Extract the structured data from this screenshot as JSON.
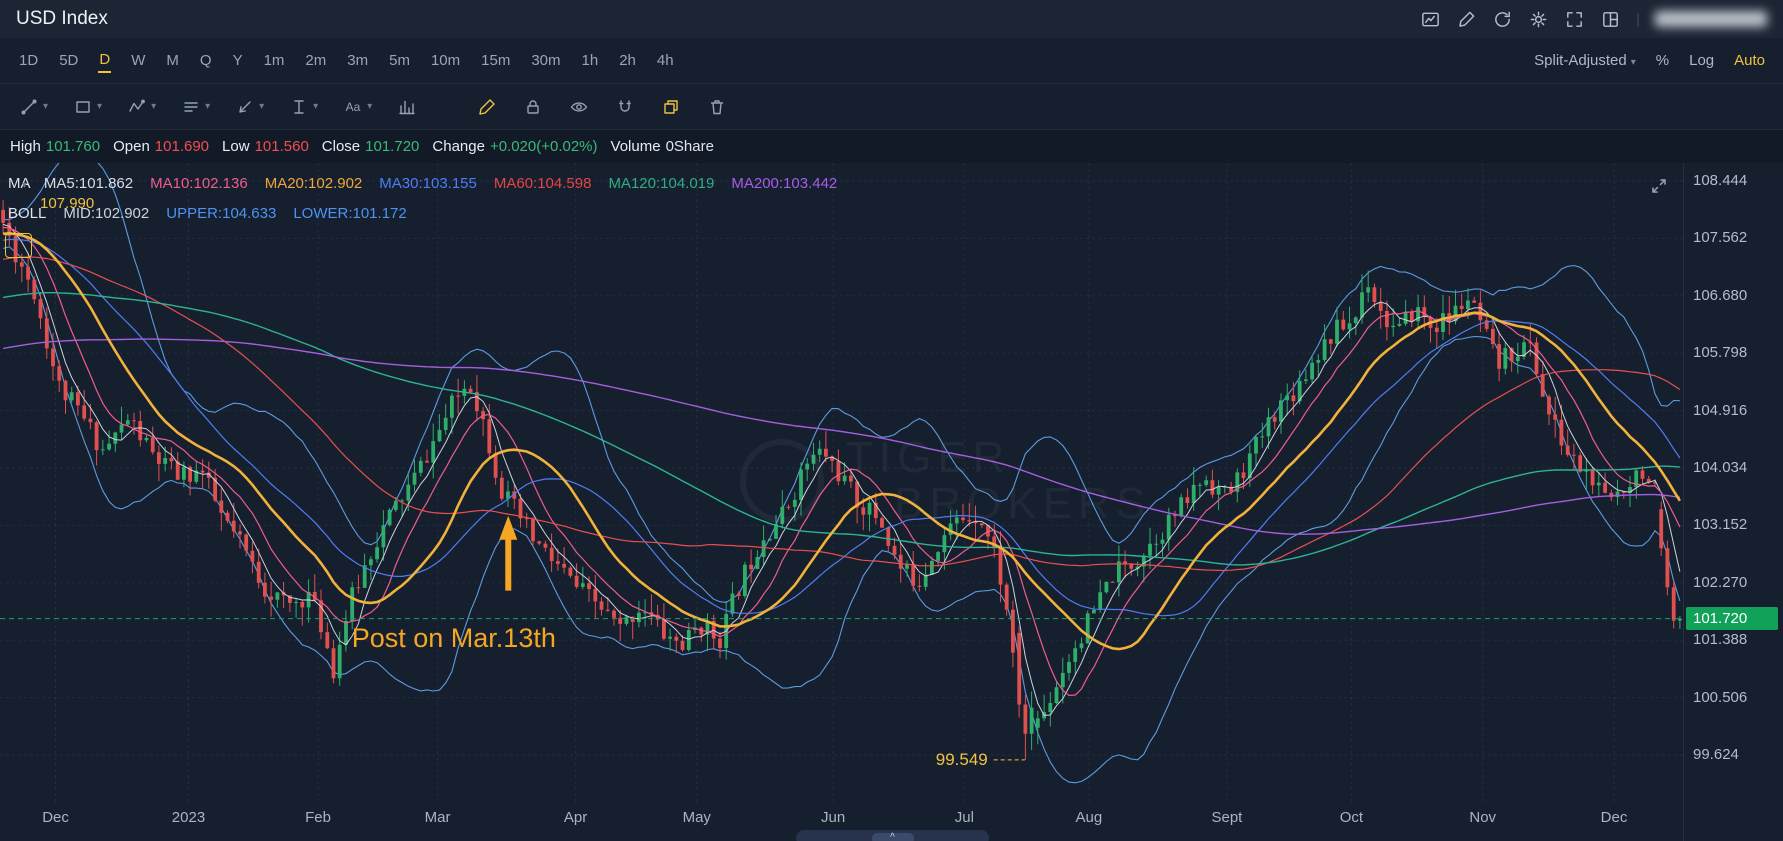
{
  "header": {
    "title": "USD Index",
    "icons": [
      "screenshot-icon",
      "edit-chart-icon",
      "refresh-icon",
      "settings-icon",
      "fullscreen-icon",
      "layout-grid-icon"
    ]
  },
  "timeframe_bar": {
    "items": [
      {
        "label": "1D"
      },
      {
        "label": "5D"
      },
      {
        "label": "D",
        "active": true
      },
      {
        "label": "W"
      },
      {
        "label": "M"
      },
      {
        "label": "Q"
      },
      {
        "label": "Y"
      },
      {
        "label": "1m"
      },
      {
        "label": "2m"
      },
      {
        "label": "3m"
      },
      {
        "label": "5m"
      },
      {
        "label": "10m"
      },
      {
        "label": "15m"
      },
      {
        "label": "30m"
      },
      {
        "label": "1h"
      },
      {
        "label": "2h"
      },
      {
        "label": "4h"
      }
    ],
    "right": {
      "adjust_label": "Split-Adjusted",
      "percent_label": "%",
      "log_label": "Log",
      "auto_label": "Auto"
    }
  },
  "toolbar": {
    "tools": [
      "trend-line",
      "rectangle",
      "wave",
      "parallel-lines",
      "arrow",
      "price-range",
      "text",
      "volume-profile"
    ],
    "actions": [
      "brush",
      "lock",
      "visibility",
      "magnet",
      "duplicate",
      "delete"
    ],
    "text_tool_glyph": "Aa"
  },
  "ohlc": {
    "items": [
      {
        "label": "High",
        "value": "101.760",
        "color": "#3cb878"
      },
      {
        "label": "Open",
        "value": "101.690",
        "color": "#f04f4f"
      },
      {
        "label": "Low",
        "value": "101.560",
        "color": "#f04f4f"
      },
      {
        "label": "Close",
        "value": "101.720",
        "color": "#3cb878"
      },
      {
        "label": "Change",
        "value": "+0.020(+0.02%)",
        "color": "#3cb878"
      },
      {
        "label": "Volume",
        "value": "0Share",
        "color": "#dfe4ec"
      }
    ]
  },
  "indicators": {
    "ma": {
      "label": "MA",
      "entries": [
        {
          "label": "MA5:101.862",
          "color": "#d9dde6"
        },
        {
          "label": "MA10:102.136",
          "color": "#ef5d8c"
        },
        {
          "label": "MA20:102.902",
          "color": "#f0a63c"
        },
        {
          "label": "MA30:103.155",
          "color": "#4f7df2"
        },
        {
          "label": "MA60:104.598",
          "color": "#e64545"
        },
        {
          "label": "MA120:104.019",
          "color": "#2fae85"
        },
        {
          "label": "MA200:103.442",
          "color": "#a75ce8"
        }
      ]
    },
    "boll": {
      "label": "BOLL",
      "entries": [
        {
          "label": "MID:102.902",
          "color": "#ccd3e0"
        },
        {
          "label": "UPPER:104.633",
          "color": "#4f93f0"
        },
        {
          "label": "LOWER:101.172",
          "color": "#4f93f0"
        }
      ]
    },
    "drawing_price_label": "107.990"
  },
  "watermark": {
    "line1": "TIGER",
    "line2": "BROKERS"
  },
  "chart_data": {
    "type": "candlestick",
    "symbol": "USD Index",
    "x_ticks": [
      "Dec",
      "2023",
      "Feb",
      "Mar",
      "Apr",
      "May",
      "Jun",
      "Jul",
      "Aug",
      "Sept",
      "Oct",
      "Nov",
      "Dec"
    ],
    "x_tick_fracs": [
      0.033,
      0.112,
      0.189,
      0.26,
      0.342,
      0.414,
      0.495,
      0.573,
      0.647,
      0.729,
      0.803,
      0.881,
      0.959
    ],
    "y_ticks": [
      "108.444",
      "107.562",
      "106.680",
      "105.798",
      "104.916",
      "104.034",
      "103.152",
      "102.270",
      "101.388",
      "100.506",
      "99.624"
    ],
    "current_price": "101.720",
    "last_candle": {
      "open": 101.69,
      "high": 101.76,
      "low": 101.56,
      "close": 101.72
    },
    "low_of_period": 99.549,
    "price_path": [
      [
        0,
        107.8
      ],
      [
        0.008,
        107.3
      ],
      [
        0.018,
        106.8
      ],
      [
        0.033,
        105.3
      ],
      [
        0.045,
        104.9
      ],
      [
        0.06,
        104.3
      ],
      [
        0.075,
        104.8
      ],
      [
        0.09,
        104.2
      ],
      [
        0.105,
        103.9
      ],
      [
        0.118,
        104.0
      ],
      [
        0.13,
        103.3
      ],
      [
        0.143,
        102.8
      ],
      [
        0.156,
        102.2
      ],
      [
        0.17,
        101.9
      ],
      [
        0.182,
        102.1
      ],
      [
        0.19,
        101.6
      ],
      [
        0.197,
        100.95
      ],
      [
        0.206,
        101.9
      ],
      [
        0.22,
        102.8
      ],
      [
        0.233,
        103.4
      ],
      [
        0.246,
        103.9
      ],
      [
        0.258,
        104.5
      ],
      [
        0.27,
        105.1
      ],
      [
        0.278,
        105.4
      ],
      [
        0.287,
        104.7
      ],
      [
        0.297,
        103.7
      ],
      [
        0.306,
        103.35
      ],
      [
        0.317,
        102.9
      ],
      [
        0.33,
        102.55
      ],
      [
        0.342,
        102.2
      ],
      [
        0.356,
        101.9
      ],
      [
        0.368,
        101.55
      ],
      [
        0.381,
        101.95
      ],
      [
        0.393,
        101.5
      ],
      [
        0.406,
        101.3
      ],
      [
        0.415,
        101.65
      ],
      [
        0.427,
        101.4
      ],
      [
        0.44,
        102.3
      ],
      [
        0.453,
        103.0
      ],
      [
        0.466,
        103.35
      ],
      [
        0.479,
        104.1
      ],
      [
        0.489,
        104.3
      ],
      [
        0.497,
        104.0
      ],
      [
        0.51,
        103.5
      ],
      [
        0.523,
        103.25
      ],
      [
        0.534,
        102.5
      ],
      [
        0.546,
        102.3
      ],
      [
        0.558,
        102.9
      ],
      [
        0.57,
        103.25
      ],
      [
        0.582,
        103.35
      ],
      [
        0.593,
        102.6
      ],
      [
        0.602,
        101.3
      ],
      [
        0.61,
        99.95
      ],
      [
        0.62,
        100.25
      ],
      [
        0.633,
        101.0
      ],
      [
        0.648,
        101.7
      ],
      [
        0.662,
        102.4
      ],
      [
        0.675,
        102.6
      ],
      [
        0.688,
        103.0
      ],
      [
        0.702,
        103.4
      ],
      [
        0.716,
        103.9
      ],
      [
        0.73,
        103.6
      ],
      [
        0.744,
        104.2
      ],
      [
        0.758,
        104.9
      ],
      [
        0.772,
        105.3
      ],
      [
        0.786,
        105.9
      ],
      [
        0.797,
        106.2
      ],
      [
        0.806,
        106.3
      ],
      [
        0.813,
        107.0
      ],
      [
        0.822,
        106.4
      ],
      [
        0.832,
        106.1
      ],
      [
        0.842,
        106.5
      ],
      [
        0.852,
        106.2
      ],
      [
        0.863,
        106.35
      ],
      [
        0.873,
        106.65
      ],
      [
        0.882,
        106.2
      ],
      [
        0.891,
        105.6
      ],
      [
        0.901,
        105.85
      ],
      [
        0.911,
        105.9
      ],
      [
        0.921,
        104.9
      ],
      [
        0.933,
        104.25
      ],
      [
        0.946,
        103.9
      ],
      [
        0.956,
        103.5
      ],
      [
        0.966,
        103.75
      ],
      [
        0.977,
        104.05
      ],
      [
        0.987,
        103.55
      ],
      [
        0.994,
        102.6
      ],
      [
        1,
        101.72
      ]
    ],
    "annotations": {
      "arrow": {
        "text": "Post on Mar.13th",
        "color": "#f5a623",
        "x_frac": 0.302,
        "tip_price": 103.3,
        "tail_price": 102.15,
        "text_x_frac": 0.209,
        "text_y_price": 101.42
      },
      "low_note": {
        "text": "99.549",
        "color": "#f0c242",
        "price": 99.549,
        "x_frac": 0.556,
        "dash_to_x_frac": 0.609
      }
    },
    "colors": {
      "up": "#2fae6a",
      "down": "#e0504f",
      "grid": "rgba(151,166,195,0.10)",
      "current_line": "#1fa160",
      "current_label_bg": "#12a159",
      "band": "#5d9be0",
      "ma5": "#ccd3df",
      "ma10": "#ef5d8c",
      "ma20": "#f0b23c",
      "ma30": "#4f7df2",
      "ma60": "#e8504f",
      "ma120": "#2db394",
      "ma200": "#a45fe0"
    }
  }
}
